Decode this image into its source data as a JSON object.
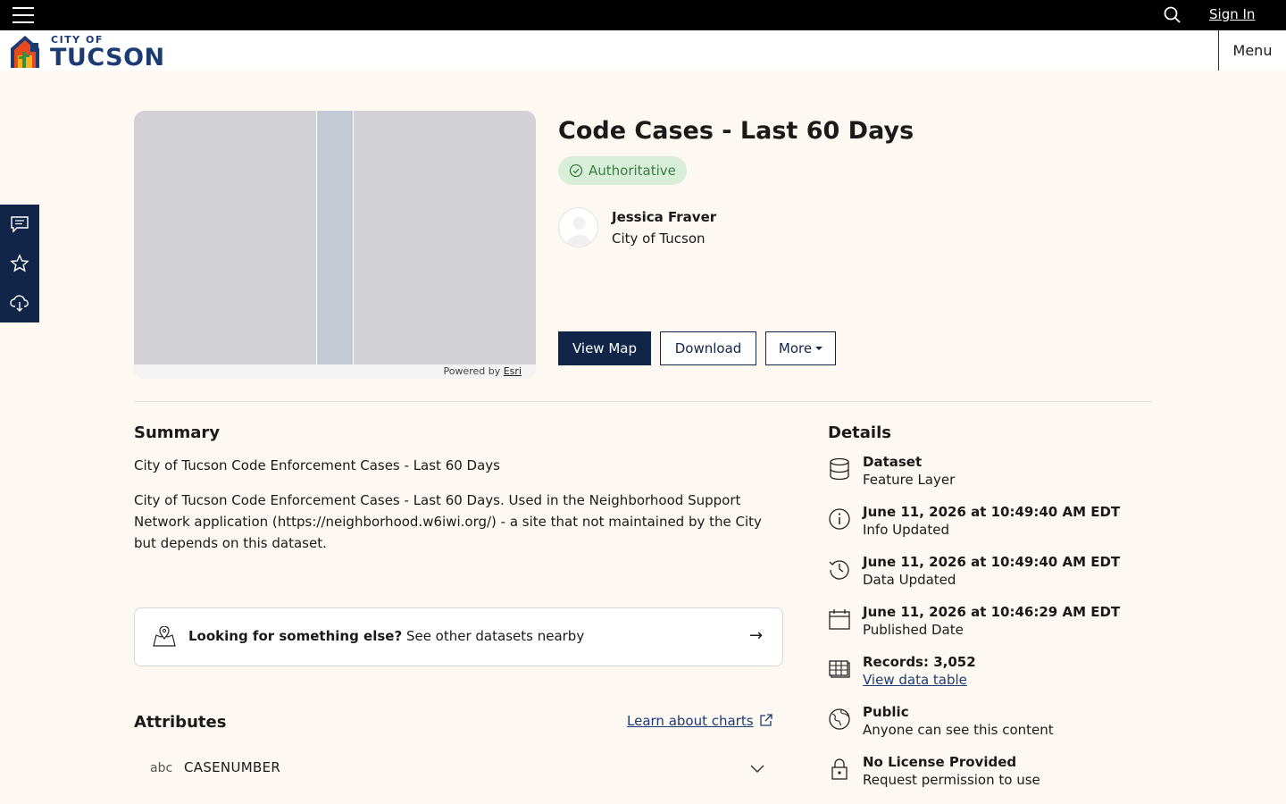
{
  "topbar": {
    "sign_in": "Sign In"
  },
  "header": {
    "logo_city": "CITY OF",
    "logo_name": "TUCSON",
    "menu_label": "Menu"
  },
  "thumbnail": {
    "powered_by": "Powered by ",
    "esri": "Esri"
  },
  "item": {
    "title": "Code Cases - Last 60 Days",
    "badge": "Authoritative",
    "owner_name": "Jessica Fraver",
    "owner_org": "City of Tucson"
  },
  "actions": {
    "view_map": "View Map",
    "download": "Download",
    "more": "More"
  },
  "summary": {
    "heading": "Summary",
    "short": "City of Tucson Code Enforcement Cases - Last 60 Days",
    "long": "City of Tucson Code Enforcement Cases - Last 60 Days. Used in the Neighborhood Support Network application (https://neighborhood.w6iwi.org/) - a site that not maintained by the City but depends on this dataset."
  },
  "nearby": {
    "bold": "Looking for something else?",
    "rest": " See other datasets nearby",
    "arrow": "→"
  },
  "attributes": {
    "heading": "Attributes",
    "learn": "Learn about charts",
    "fields": [
      {
        "type": "abc",
        "name": "CASENUMBER"
      }
    ]
  },
  "details": {
    "heading": "Details",
    "items": [
      {
        "icon": "database-icon",
        "title": "Dataset",
        "sub": "Feature Layer"
      },
      {
        "icon": "info-icon",
        "title": "June 11, 2026 at 10:49:40 AM EDT",
        "sub": "Info Updated"
      },
      {
        "icon": "history-icon",
        "title": "June 11, 2026 at 10:49:40 AM EDT",
        "sub": "Data Updated"
      },
      {
        "icon": "calendar-icon",
        "title": "June 11, 2026 at 10:46:29 AM EDT",
        "sub": "Published Date"
      },
      {
        "icon": "table-icon",
        "title": "Records: 3,052",
        "sub": "View data table"
      },
      {
        "icon": "globe-icon",
        "title": "Public",
        "sub": "Anyone can see this content"
      },
      {
        "icon": "lock-icon",
        "title": "No License Provided",
        "sub": "Request permission to use"
      }
    ]
  }
}
